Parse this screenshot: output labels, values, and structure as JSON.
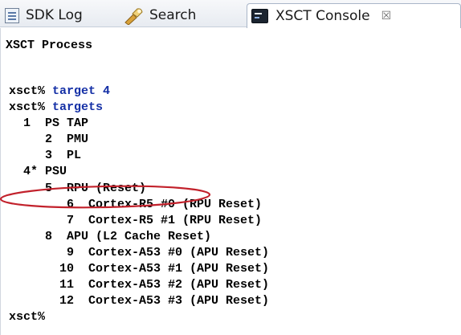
{
  "tabs": [
    {
      "label": "SDK Log",
      "icon": "sdk-log-icon"
    },
    {
      "label": "Search",
      "icon": "search-icon"
    },
    {
      "label": "XSCT Console",
      "icon": "console-icon",
      "active": true,
      "close_glyph": "☒"
    }
  ],
  "console": {
    "title": "XSCT Process",
    "lines": [
      {
        "prompt": "xsct%",
        "command": "target 4"
      },
      {
        "prompt": "xsct%",
        "command": "targets"
      },
      {
        "text": "  1  PS TAP"
      },
      {
        "text": "     2  PMU"
      },
      {
        "text": "     3  PL"
      },
      {
        "text": "  4* PSU"
      },
      {
        "text": "     5  RPU (Reset)"
      },
      {
        "text": "        6  Cortex-R5 #0 (RPU Reset)"
      },
      {
        "text": "        7  Cortex-R5 #1 (RPU Reset)"
      },
      {
        "text": "     8  APU (L2 Cache Reset)"
      },
      {
        "text": "        9  Cortex-A53 #0 (APU Reset)"
      },
      {
        "text": "       10  Cortex-A53 #1 (APU Reset)"
      },
      {
        "text": "       11  Cortex-A53 #2 (APU Reset)"
      },
      {
        "text": "       12  Cortex-A53 #3 (APU Reset)"
      },
      {
        "prompt": "xsct%",
        "command": ""
      }
    ],
    "highlighted_line_index": 5
  },
  "colors": {
    "command_text": "#1530a6",
    "highlight_ellipse": "#c2212b",
    "tab_bar_bg": "#e7ebf1"
  }
}
